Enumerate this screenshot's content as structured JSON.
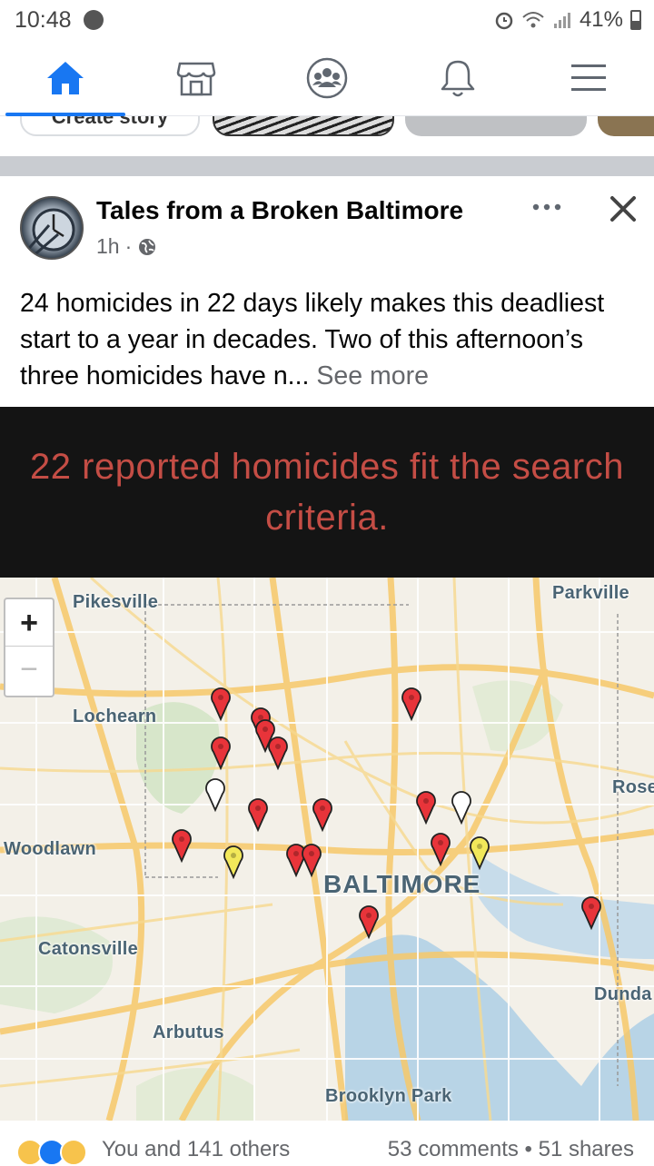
{
  "status_bar": {
    "time": "10:48",
    "battery": "41%"
  },
  "nav": {
    "items": [
      {
        "name": "home",
        "icon": "home-icon"
      },
      {
        "name": "marketplace",
        "icon": "marketplace-icon"
      },
      {
        "name": "groups",
        "icon": "groups-icon"
      },
      {
        "name": "notifications",
        "icon": "bell-icon"
      },
      {
        "name": "menu",
        "icon": "menu-icon"
      }
    ],
    "active": "home",
    "accent": "#1877f2"
  },
  "stories": {
    "create_label": "Create story"
  },
  "post": {
    "page_name": "Tales from a Broken Baltimore",
    "time": "1h",
    "separator": "·",
    "audience_icon": "globe-icon",
    "text": "24 homicides in 22 days likely makes this deadliest start to a year in decades.  Two of this afternoon’s three homicides have n...",
    "see_more": "See more",
    "banner": "22 reported homicides fit the search criteria.",
    "map": {
      "zoom_in": "+",
      "zoom_out": "−",
      "places": {
        "pikesville": "Pikesville",
        "parkville": "Parkville",
        "lochearn": "Lochearn",
        "rosedale": "Rose",
        "woodlawn": "Woodlawn",
        "baltimore": "BALTIMORE",
        "catonsville": "Catonsville",
        "dundalk": "Dunda",
        "arbutus": "Arbutus",
        "brooklyn_park": "Brooklyn Park"
      },
      "marker_colors": {
        "red": "#e8343a",
        "yellow": "#f2e85a",
        "white": "#ffffff"
      }
    },
    "reactions_text": "You and 141 others",
    "stats_text": "53 comments • 51 shares"
  }
}
